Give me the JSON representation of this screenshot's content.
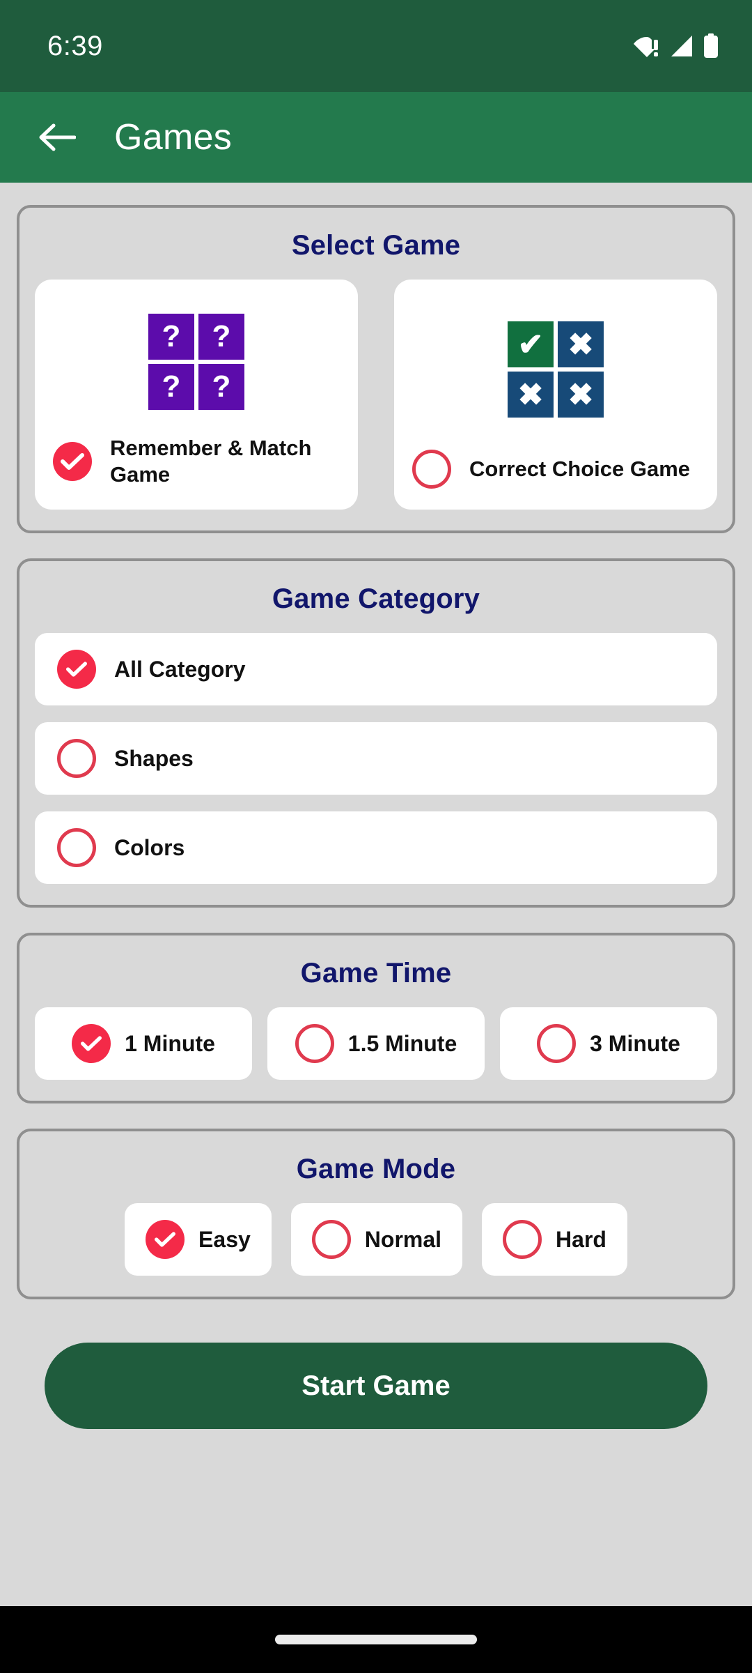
{
  "status_bar": {
    "time": "6:39",
    "icons": [
      "wifi-alert-icon",
      "cellular-signal-icon",
      "battery-full-icon"
    ]
  },
  "app_bar": {
    "back_icon": "back-arrow-icon",
    "title": "Games"
  },
  "colors": {
    "status_bar_green": "#1f5c3d",
    "app_bar_green": "#237a4d",
    "page_background": "#d9d9d9",
    "section_border": "#8f8f8f",
    "section_title_navy": "#11166b",
    "radio_selected_red": "#f42a48",
    "radio_unselected_red": "#e03a4e",
    "memory_tile_purple": "#5c0cab",
    "correct_tile_green": "#11703f",
    "correct_tile_navy": "#174a78",
    "start_button_green": "#1f5c3d",
    "card_white": "#ffffff"
  },
  "sections": {
    "select_game": {
      "title": "Select Game",
      "options": [
        {
          "label": "Remember & Match Game",
          "selected": true,
          "icon": "memory-tiles-icon",
          "tiles": [
            {
              "style": "q",
              "glyph": "?"
            },
            {
              "style": "q",
              "glyph": "?"
            },
            {
              "style": "q",
              "glyph": "?"
            },
            {
              "style": "q",
              "glyph": "?"
            }
          ]
        },
        {
          "label": "Correct Choice Game",
          "selected": false,
          "icon": "correct-choice-tiles-icon",
          "tiles": [
            {
              "style": "green",
              "glyph": "✔"
            },
            {
              "style": "navy",
              "glyph": "✖"
            },
            {
              "style": "navy",
              "glyph": "✖"
            },
            {
              "style": "navy",
              "glyph": "✖"
            }
          ]
        }
      ]
    },
    "game_category": {
      "title": "Game Category",
      "options": [
        {
          "label": "All Category",
          "selected": true
        },
        {
          "label": "Shapes",
          "selected": false
        },
        {
          "label": "Colors",
          "selected": false
        }
      ]
    },
    "game_time": {
      "title": "Game Time",
      "options": [
        {
          "label": "1 Minute",
          "selected": true
        },
        {
          "label": "1.5 Minute",
          "selected": false
        },
        {
          "label": "3 Minute",
          "selected": false
        }
      ]
    },
    "game_mode": {
      "title": "Game Mode",
      "options": [
        {
          "label": "Easy",
          "selected": true
        },
        {
          "label": "Normal",
          "selected": false
        },
        {
          "label": "Hard",
          "selected": false
        }
      ]
    }
  },
  "start_button": {
    "label": "Start Game"
  },
  "nav_bar": {
    "gesture_pill": "home-gesture-pill"
  }
}
